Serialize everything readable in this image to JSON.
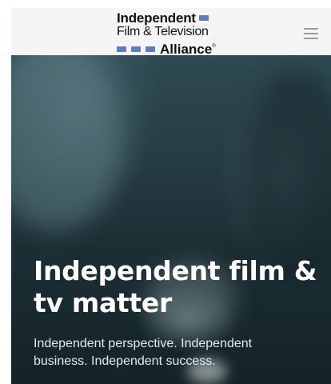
{
  "header": {
    "logo": {
      "line1": "Independent",
      "line2": "Film & Television",
      "line3": "Alliance",
      "registered_mark": "®"
    },
    "menu_icon": "hamburger-menu-icon"
  },
  "hero": {
    "title": "Independent film & tv matter",
    "subtitle": "Independent perspective. Independent business. Independent success."
  },
  "colors": {
    "brand_blue": "#5b7fb7",
    "header_bg": "#f5f5f5",
    "hero_text": "#ffffff"
  }
}
